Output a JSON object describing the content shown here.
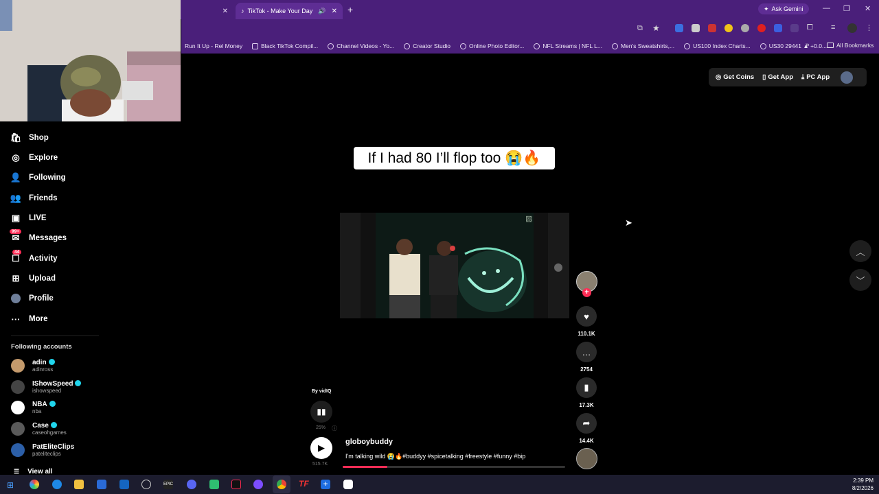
{
  "browser": {
    "tabs": [
      {
        "title": "",
        "close": "✕"
      },
      {
        "title": "TikTok - Make Your Day",
        "close": "✕"
      }
    ],
    "new_tab": "+",
    "ask_gemini": "Ask Gemini",
    "bookmarks": [
      "Run It Up - Rel Money",
      "Black TikTok Compil...",
      "Channel Videos - Yo...",
      "Creator Studio",
      "Online Photo Editor...",
      "NFL Streams | NFL L...",
      "Men's Sweatshirts,...",
      "US100 Index Charts...",
      "US30 29441 ▲ +0.0..."
    ],
    "bookmarks_more": "»",
    "all_bookmarks": "All Bookmarks"
  },
  "sidebar": {
    "nav": [
      {
        "label": "Shop",
        "icon": "shop-icon"
      },
      {
        "label": "Explore",
        "icon": "compass-icon"
      },
      {
        "label": "Following",
        "icon": "following-icon"
      },
      {
        "label": "Friends",
        "icon": "friends-icon"
      },
      {
        "label": "LIVE",
        "icon": "live-icon"
      },
      {
        "label": "Messages",
        "icon": "messages-icon",
        "badge": "99+"
      },
      {
        "label": "Activity",
        "icon": "activity-icon",
        "badge": "44"
      },
      {
        "label": "Upload",
        "icon": "upload-icon"
      },
      {
        "label": "Profile",
        "icon": "profile-icon"
      },
      {
        "label": "More",
        "icon": "more-icon"
      }
    ],
    "following_title": "Following accounts",
    "accounts": [
      {
        "name": "adin",
        "handle": "adinross",
        "verified": true
      },
      {
        "name": "IShowSpeed",
        "handle": "ishowspeed",
        "verified": true
      },
      {
        "name": "NBA",
        "handle": "nba",
        "verified": true
      },
      {
        "name": "Case",
        "handle": "caseohgames",
        "verified": true
      },
      {
        "name": "PatEliteClips",
        "handle": "pateliteclips",
        "verified": false
      }
    ],
    "view_all": "View all"
  },
  "header": {
    "get_coins": "Get Coins",
    "get_app": "Get App",
    "pc_app": "PC App"
  },
  "video": {
    "caption": "If I had 80 I’ll flop too 😭🔥",
    "by": "By vidIQ",
    "pct": "25%",
    "views": "515.7K",
    "author": "globoybuddy",
    "description": "I'm talking wild 😭🔥#buddyy #spicetalking #freestyle #funny #bip",
    "progress": 0.2
  },
  "actions": {
    "likes": "110.1K",
    "comments": "2754",
    "saves": "17.3K",
    "shares": "14.4K"
  },
  "taskbar": {
    "time": "2:39 PM",
    "date": "8/2/2026"
  },
  "colors": {
    "browser_purple": "#4a1f7a",
    "tiktok_red": "#fe2c55",
    "verified": "#20d5ec"
  }
}
